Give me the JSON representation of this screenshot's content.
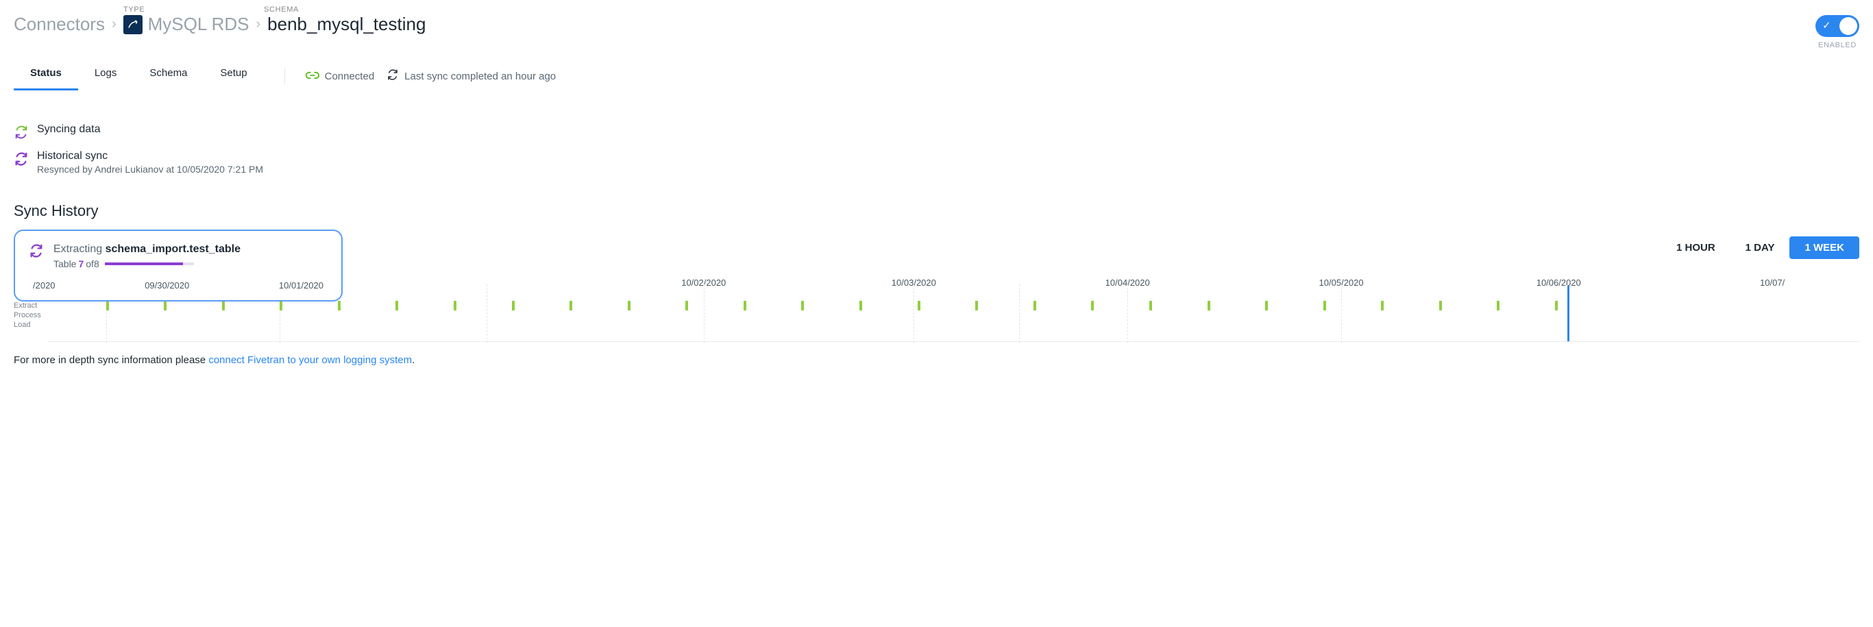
{
  "header": {
    "label_type": "TYPE",
    "label_schema": "SCHEMA",
    "breadcrumb_root": "Connectors",
    "connector_name": "MySQL RDS",
    "schema_name": "benb_mysql_testing",
    "toggle_label": "ENABLED"
  },
  "tabs": {
    "items": [
      "Status",
      "Logs",
      "Schema",
      "Setup"
    ],
    "active": 0
  },
  "status_bar": {
    "connected": "Connected",
    "last_sync": "Last sync completed an hour ago"
  },
  "sync": {
    "syncing_title": "Syncing data",
    "historical_title": "Historical sync",
    "historical_sub": "Resynced by Andrei Lukianov at 10/05/2020 7:21 PM"
  },
  "section_title": "Sync History",
  "extract": {
    "prefix": "Extracting ",
    "table": "schema_import.test_table",
    "progress_prefix": "Table ",
    "progress_current": "7",
    "progress_mid": " of ",
    "progress_total": "8",
    "mini_dates": [
      "/2020",
      "09/30/2020",
      "10/01/2020"
    ]
  },
  "range": {
    "options": [
      "1 HOUR",
      "1 DAY",
      "1 WEEK"
    ]
  },
  "timeline": {
    "row_labels": [
      "Extract",
      "Process",
      "Load"
    ],
    "dates": [
      {
        "label": "10/02/2020",
        "pct": 36.2
      },
      {
        "label": "10/03/2020",
        "pct": 47.8
      },
      {
        "label": "10/04/2020",
        "pct": 59.6
      },
      {
        "label": "10/05/2020",
        "pct": 71.4
      },
      {
        "label": "10/06/2020",
        "pct": 83.4
      },
      {
        "label": "10/07/",
        "pct": 95.2
      }
    ],
    "now_pct": 83.9,
    "ticks_pct": [
      3.2,
      6.4,
      9.6,
      12.8,
      16.0,
      19.2,
      22.4,
      25.6,
      28.8,
      32.0,
      35.2,
      38.4,
      41.6,
      44.8,
      48.0,
      51.2,
      54.4,
      57.6,
      60.8,
      64.0,
      67.2,
      70.4,
      73.6,
      76.8,
      80.0,
      83.2
    ],
    "grids_pct": [
      3.2,
      12.8,
      24.2,
      36.2,
      47.8,
      53.6,
      59.6,
      71.4,
      83.9
    ]
  },
  "footer": {
    "prefix": "For more in depth sync information please ",
    "link": "connect Fivetran to your own logging system",
    "suffix": "."
  }
}
